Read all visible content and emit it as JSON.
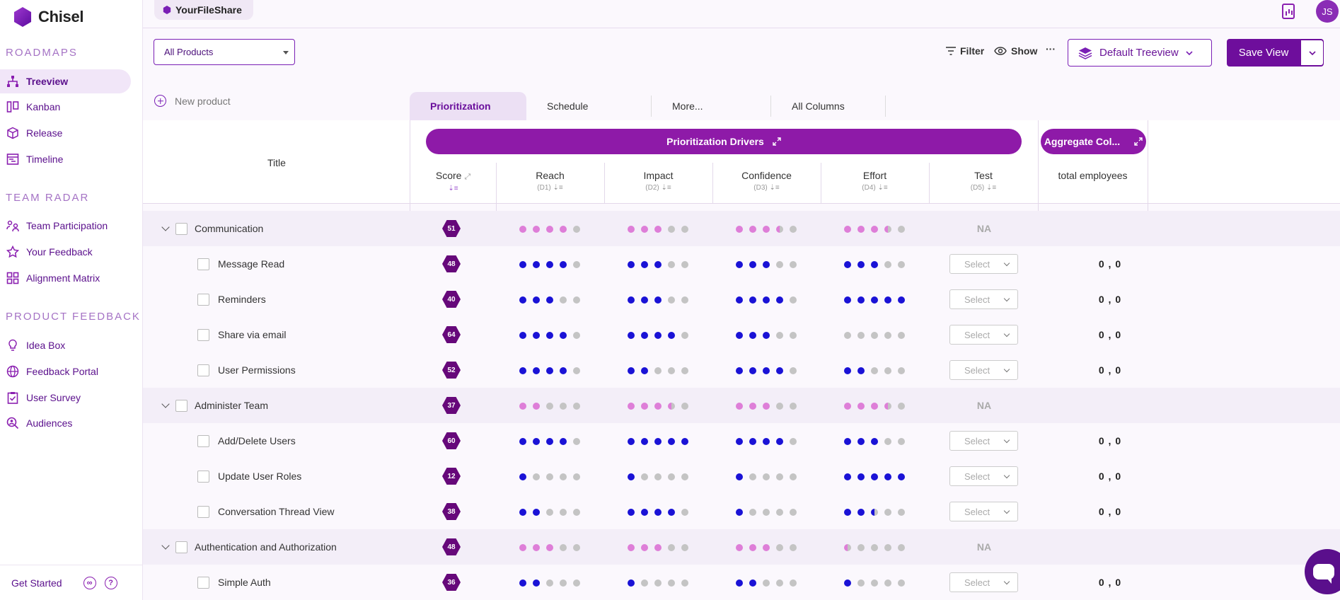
{
  "app": {
    "name": "Chisel",
    "workspace": "YourFileShare",
    "user_initials": "JS"
  },
  "sidebar": {
    "sections": [
      {
        "title": "ROADMAPS",
        "items": [
          {
            "label": "Treeview",
            "icon": "treeview-icon",
            "active": true
          },
          {
            "label": "Kanban",
            "icon": "kanban-icon"
          },
          {
            "label": "Release",
            "icon": "release-icon"
          },
          {
            "label": "Timeline",
            "icon": "timeline-icon"
          }
        ]
      },
      {
        "title": "TEAM RADAR",
        "items": [
          {
            "label": "Team Participation",
            "icon": "team-participation-icon"
          },
          {
            "label": "Your Feedback",
            "icon": "star-icon"
          },
          {
            "label": "Alignment Matrix",
            "icon": "grid-icon"
          }
        ]
      },
      {
        "title": "PRODUCT FEEDBACK",
        "items": [
          {
            "label": "Idea Box",
            "icon": "lightbulb-icon"
          },
          {
            "label": "Feedback Portal",
            "icon": "globe-icon"
          },
          {
            "label": "User Survey",
            "icon": "clipboard-icon"
          },
          {
            "label": "Audiences",
            "icon": "search-people-icon"
          }
        ]
      }
    ],
    "footer": {
      "get_started": "Get Started"
    }
  },
  "toolbar": {
    "products_select": "All Products",
    "filter": "Filter",
    "show": "Show",
    "more": "···",
    "view_select": "Default Treeview",
    "save_view": "Save View"
  },
  "table": {
    "new_product": "New product",
    "tabs": [
      "Prioritization",
      "Schedule",
      "More...",
      "All Columns"
    ],
    "title_header": "Title",
    "group_pills": {
      "drivers": "Prioritization Drivers",
      "aggregate": "Aggregate Col..."
    },
    "columns": [
      {
        "label": "Score",
        "sub": ""
      },
      {
        "label": "Reach",
        "sub": "(D1)"
      },
      {
        "label": "Impact",
        "sub": "(D2)"
      },
      {
        "label": "Confidence",
        "sub": "(D3)"
      },
      {
        "label": "Effort",
        "sub": "(D4)"
      },
      {
        "label": "Test",
        "sub": "(D5)"
      },
      {
        "label": "total employees",
        "sub": ""
      }
    ],
    "select_placeholder": "Select",
    "na": "NA",
    "rows": [
      {
        "title": "Communication",
        "group": true,
        "score": "51",
        "reach": [
          "p",
          "p",
          "p",
          "p",
          "e"
        ],
        "impact": [
          "p",
          "p",
          "p",
          "e",
          "e"
        ],
        "confidence": [
          "p",
          "p",
          "p",
          "hp",
          "e"
        ],
        "effort": [
          "p",
          "p",
          "p",
          "hp",
          "e"
        ],
        "test": "NA",
        "total": ""
      },
      {
        "title": "Message Read",
        "group": false,
        "score": "48",
        "reach": [
          "f",
          "f",
          "f",
          "f",
          "e"
        ],
        "impact": [
          "f",
          "f",
          "f",
          "e",
          "e"
        ],
        "confidence": [
          "f",
          "f",
          "f",
          "e",
          "e"
        ],
        "effort": [
          "f",
          "f",
          "f",
          "e",
          "e"
        ],
        "test": "Select",
        "total": "0 , 0"
      },
      {
        "title": "Reminders",
        "group": false,
        "score": "40",
        "reach": [
          "f",
          "f",
          "f",
          "e",
          "e"
        ],
        "impact": [
          "f",
          "f",
          "f",
          "e",
          "e"
        ],
        "confidence": [
          "f",
          "f",
          "f",
          "f",
          "e"
        ],
        "effort": [
          "f",
          "f",
          "f",
          "f",
          "f"
        ],
        "test": "Select",
        "total": "0 , 0"
      },
      {
        "title": "Share via email",
        "group": false,
        "score": "64",
        "reach": [
          "f",
          "f",
          "f",
          "f",
          "e"
        ],
        "impact": [
          "f",
          "f",
          "f",
          "f",
          "e"
        ],
        "confidence": [
          "f",
          "f",
          "f",
          "e",
          "e"
        ],
        "effort": [
          "e",
          "e",
          "e",
          "e",
          "e"
        ],
        "test": "Select",
        "total": "0 , 0"
      },
      {
        "title": "User Permissions",
        "group": false,
        "score": "52",
        "reach": [
          "f",
          "f",
          "f",
          "f",
          "e"
        ],
        "impact": [
          "f",
          "f",
          "e",
          "e",
          "e"
        ],
        "confidence": [
          "f",
          "f",
          "f",
          "f",
          "e"
        ],
        "effort": [
          "f",
          "f",
          "e",
          "e",
          "e"
        ],
        "test": "Select",
        "total": "0 , 0"
      },
      {
        "title": "Administer Team",
        "group": true,
        "score": "37",
        "reach": [
          "p",
          "p",
          "e",
          "e",
          "e"
        ],
        "impact": [
          "p",
          "p",
          "p",
          "hp",
          "e"
        ],
        "confidence": [
          "p",
          "p",
          "p",
          "e",
          "e"
        ],
        "effort": [
          "p",
          "p",
          "p",
          "hp",
          "e"
        ],
        "test": "NA",
        "total": ""
      },
      {
        "title": "Add/Delete Users",
        "group": false,
        "score": "60",
        "reach": [
          "f",
          "f",
          "f",
          "f",
          "e"
        ],
        "impact": [
          "f",
          "f",
          "f",
          "f",
          "f"
        ],
        "confidence": [
          "f",
          "f",
          "f",
          "f",
          "e"
        ],
        "effort": [
          "f",
          "f",
          "f",
          "e",
          "e"
        ],
        "test": "Select",
        "total": "0 , 0"
      },
      {
        "title": "Update User Roles",
        "group": false,
        "score": "12",
        "reach": [
          "f",
          "e",
          "e",
          "e",
          "e"
        ],
        "impact": [
          "f",
          "e",
          "e",
          "e",
          "e"
        ],
        "confidence": [
          "f",
          "e",
          "e",
          "e",
          "e"
        ],
        "effort": [
          "f",
          "f",
          "f",
          "f",
          "f"
        ],
        "test": "Select",
        "total": "0 , 0"
      },
      {
        "title": "Conversation Thread View",
        "group": false,
        "score": "38",
        "reach": [
          "f",
          "f",
          "e",
          "e",
          "e"
        ],
        "impact": [
          "f",
          "f",
          "f",
          "f",
          "e"
        ],
        "confidence": [
          "f",
          "e",
          "e",
          "e",
          "e"
        ],
        "effort": [
          "f",
          "f",
          "hf",
          "e",
          "e"
        ],
        "test": "Select",
        "total": "0 , 0"
      },
      {
        "title": "Authentication and Authorization",
        "group": true,
        "score": "48",
        "reach": [
          "p",
          "p",
          "p",
          "e",
          "e"
        ],
        "impact": [
          "p",
          "p",
          "p",
          "e",
          "e"
        ],
        "confidence": [
          "p",
          "p",
          "p",
          "e",
          "e"
        ],
        "effort": [
          "hp",
          "e",
          "e",
          "e",
          "e"
        ],
        "test": "NA",
        "total": ""
      },
      {
        "title": "Simple Auth",
        "group": false,
        "score": "36",
        "reach": [
          "f",
          "f",
          "e",
          "e",
          "e"
        ],
        "impact": [
          "f",
          "e",
          "e",
          "e",
          "e"
        ],
        "confidence": [
          "f",
          "f",
          "e",
          "e",
          "e"
        ],
        "effort": [
          "f",
          "e",
          "e",
          "e",
          "e"
        ],
        "test": "Select",
        "total": "0 , 0"
      }
    ]
  },
  "colors": {
    "brand": "#6e0e9c",
    "pill": "#8e1aa8",
    "dot_filled": "#1a12d6",
    "dot_pink": "#de7ed8",
    "dot_empty": "#c4c4c4"
  }
}
